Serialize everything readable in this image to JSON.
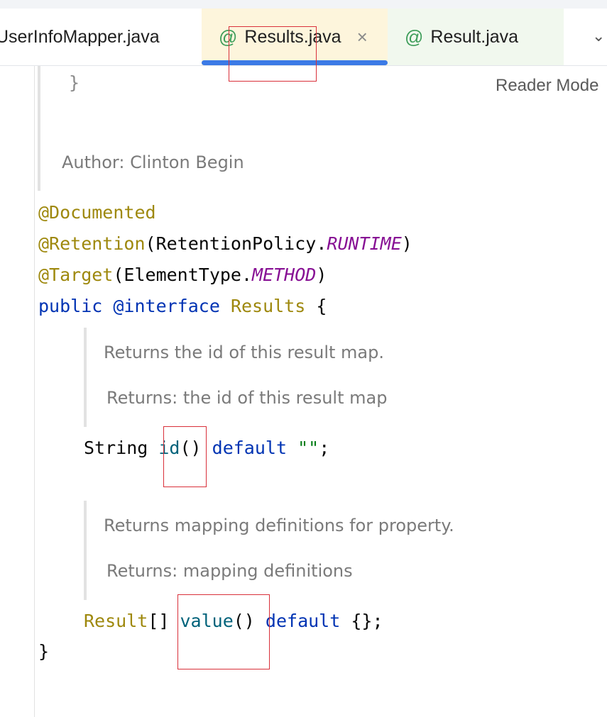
{
  "tabs": [
    {
      "label": "UserInfoMapper.java"
    },
    {
      "label": "Results.java",
      "icon": "@",
      "active": true
    },
    {
      "label": "Result.java",
      "icon": "@"
    }
  ],
  "tab_close_glyph": "×",
  "tab_more_glyph": "⌄",
  "reader_mode_label": "Reader Mode",
  "code": {
    "brace_top": "}",
    "author_doc": "Author: Clinton Begin",
    "line_documented": "@Documented",
    "line_retention": {
      "annotation": "@Retention",
      "open": "(RetentionPolicy.",
      "constant": "RUNTIME",
      "close": ")"
    },
    "line_target": {
      "annotation": "@Target",
      "open": "(ElementType.",
      "constant": "METHOD",
      "close": ")"
    },
    "line_decl": {
      "kw_public": "public",
      "kw_interface": "@interface",
      "name": "Results",
      "brace": "{"
    },
    "doc_id_summary": "Returns the id of this result map.",
    "doc_id_returns": "Returns: the id of this result map",
    "line_id": {
      "type": "String",
      "method": "id",
      "parens": "()",
      "kw_default": "default",
      "value": "\"\"",
      "end": ";"
    },
    "doc_value_summary": "Returns mapping definitions for property.",
    "doc_value_returns": "Returns: mapping definitions",
    "line_value": {
      "type": "Result",
      "brackets": "[]",
      "method": "value",
      "parens": "()",
      "kw_default": "default",
      "value": "{}",
      "end": ";"
    },
    "brace_close": "}"
  },
  "colors": {
    "annotation": "#9e880d",
    "keyword": "#0033b3",
    "constant": "#871094",
    "method": "#00627a",
    "string": "#067d17",
    "tab_active_underline": "#3b7ae6",
    "highlight_box": "#d9303a"
  }
}
